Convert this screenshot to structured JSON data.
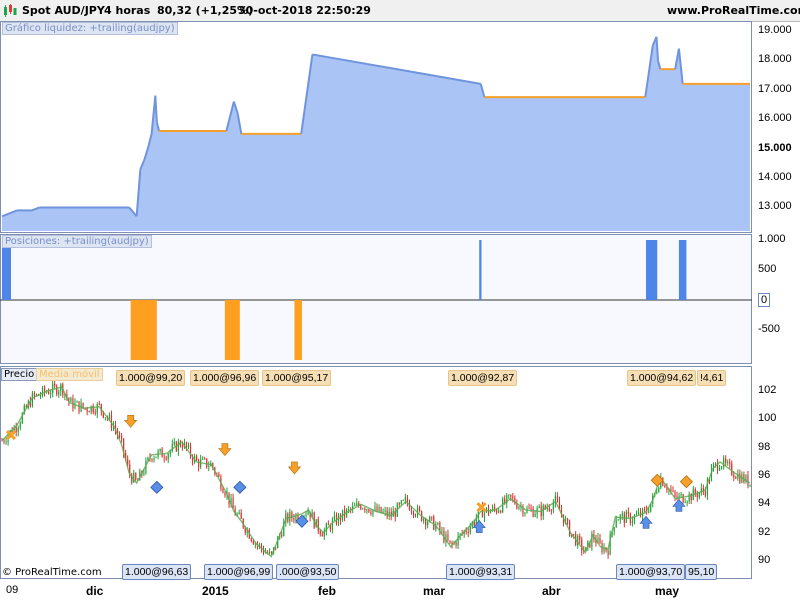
{
  "header": {
    "instrument": "Spot AUD/JPY",
    "timeframe": "4 horas",
    "price": "80,32 (+1,25%)",
    "datetime": "30-oct-2018 22:50:29",
    "site": "www.ProRealTime.com"
  },
  "footer": "© ProRealTime.com",
  "colors": {
    "accent": "#f5a02a",
    "fill": "#aac4f5",
    "line": "#6f94dc",
    "bar_up": "#4d86e8",
    "bar_down": "#ff9f1f"
  },
  "chart_data": [
    {
      "type": "area",
      "title": "Gráfico liquidez: +trailing(audjpy)",
      "ylim": [
        12.2,
        19.2
      ],
      "yticks": [
        "19.000",
        "18.000",
        "17.000",
        "16.000",
        "15.000",
        "14.000",
        "13.000"
      ],
      "bold_tick": "15.000",
      "x": [
        0,
        0.02,
        0.03,
        0.04,
        0.05,
        0.17,
        0.18,
        0.185,
        0.19,
        0.195,
        0.2,
        0.205,
        0.207,
        0.21,
        0.3,
        0.305,
        0.31,
        0.315,
        0.32,
        0.33,
        0.4,
        0.41,
        0.415,
        0.64,
        0.645,
        0.86,
        0.87,
        0.875,
        0.877,
        0.88,
        0.9,
        0.905,
        0.91,
        0.915,
        1.0
      ],
      "y": [
        12.7,
        12.9,
        12.9,
        12.9,
        13.0,
        13.0,
        12.7,
        14.3,
        14.6,
        15.0,
        15.5,
        16.8,
        15.9,
        15.6,
        15.6,
        16.1,
        16.6,
        16.2,
        15.5,
        15.5,
        15.5,
        17.3,
        18.2,
        17.2,
        16.75,
        16.75,
        18.5,
        18.8,
        18.0,
        17.7,
        17.7,
        18.4,
        17.2,
        17.2,
        17.2
      ],
      "trailing": [
        0,
        0,
        0,
        0,
        0,
        0,
        0,
        0,
        0,
        0,
        1,
        1,
        1,
        1,
        1,
        0,
        0,
        1,
        1,
        1,
        1,
        1,
        1,
        1,
        1,
        1,
        1,
        1,
        1,
        1,
        1,
        1,
        1,
        1,
        1
      ]
    },
    {
      "type": "bar",
      "title": "Posiciones: +trailing(audjpy)",
      "ylim": [
        -1000,
        1000
      ],
      "yticks": [
        "1.000",
        "500",
        "0",
        "-500"
      ],
      "x0": [
        0.0,
        0.172,
        0.298,
        0.391,
        0.638,
        0.861,
        0.905
      ],
      "x1": [
        0.012,
        0.207,
        0.318,
        0.401,
        0.641,
        0.876,
        0.915
      ],
      "values": [
        1000,
        -1000,
        -1000,
        -1000,
        1000,
        1000,
        1000
      ]
    },
    {
      "type": "line",
      "title": "Precio",
      "series_name": "Media móvil",
      "ylim": [
        89,
        103.5
      ],
      "yticks": [
        "102",
        "100",
        "98",
        "96",
        "94",
        "92",
        "90"
      ],
      "x": [
        0,
        0.02,
        0.04,
        0.06,
        0.08,
        0.09,
        0.11,
        0.13,
        0.15,
        0.16,
        0.17,
        0.18,
        0.2,
        0.22,
        0.24,
        0.26,
        0.28,
        0.3,
        0.31,
        0.32,
        0.34,
        0.36,
        0.38,
        0.4,
        0.41,
        0.42,
        0.43,
        0.44,
        0.46,
        0.48,
        0.5,
        0.52,
        0.54,
        0.56,
        0.58,
        0.6,
        0.62,
        0.63,
        0.64,
        0.66,
        0.68,
        0.7,
        0.72,
        0.74,
        0.76,
        0.78,
        0.79,
        0.8,
        0.81,
        0.82,
        0.84,
        0.86,
        0.87,
        0.88,
        0.89,
        0.9,
        0.92,
        0.94,
        0.95,
        0.96,
        0.98,
        1.0
      ],
      "y": [
        98.5,
        99.6,
        101.5,
        102.0,
        102.3,
        101.2,
        100.8,
        100.9,
        99.5,
        98.2,
        96.2,
        95.5,
        97.5,
        97.6,
        98.4,
        97.0,
        96.8,
        94.8,
        93.5,
        92.8,
        91.2,
        90.3,
        93.0,
        93.3,
        93.6,
        92.5,
        92.0,
        92.6,
        93.4,
        94.0,
        93.5,
        93.2,
        94.2,
        93.2,
        92.5,
        91.0,
        92.2,
        92.7,
        93.5,
        93.6,
        94.4,
        93.6,
        93.5,
        94.2,
        92.0,
        90.6,
        91.8,
        91.0,
        90.8,
        93.1,
        93.0,
        93.4,
        94.3,
        95.9,
        95.2,
        94.4,
        94.6,
        95.0,
        96.5,
        97.0,
        96.2,
        95.5
      ]
    }
  ],
  "top_tags": [
    "1.000@99,20",
    "1.000@96,96",
    "1.000@95,17",
    "1.000@92,87",
    "1.000@94,62",
    "!4,61"
  ],
  "bottom_tags": [
    "1.000@96,63",
    "1.000@96,99",
    ".000@93,50",
    "1.000@93,31",
    "1.000@93,70",
    "95,10"
  ],
  "x_labels": [
    "09",
    "dic",
    "2015",
    "feb",
    "mar",
    "abr",
    "may"
  ]
}
